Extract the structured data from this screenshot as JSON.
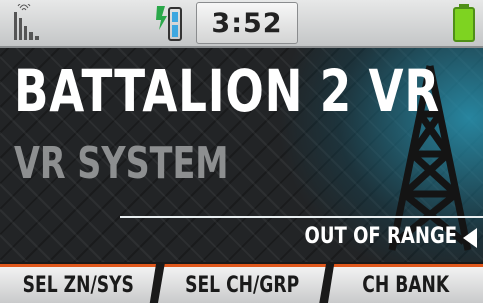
{
  "status_bar": {
    "time": "3:52",
    "icons": [
      "signal-strength-icon",
      "battery-charge-icon",
      "battery-icon"
    ]
  },
  "main": {
    "title": "BATTALION 2 VR",
    "subtitle": "VR SYSTEM",
    "range_status": "OUT OF RANGE",
    "icons": [
      "radio-tower-icon",
      "left-arrow-icon"
    ]
  },
  "softkeys": [
    {
      "label": "SEL ZN/SYS"
    },
    {
      "label": "SEL CH/GRP"
    },
    {
      "label": "CH BANK"
    }
  ],
  "colors": {
    "accent_orange": "#e0581c",
    "battery_green": "#7ed321",
    "charge_green": "#2aa84a",
    "accent_blue": "#2896b4"
  }
}
